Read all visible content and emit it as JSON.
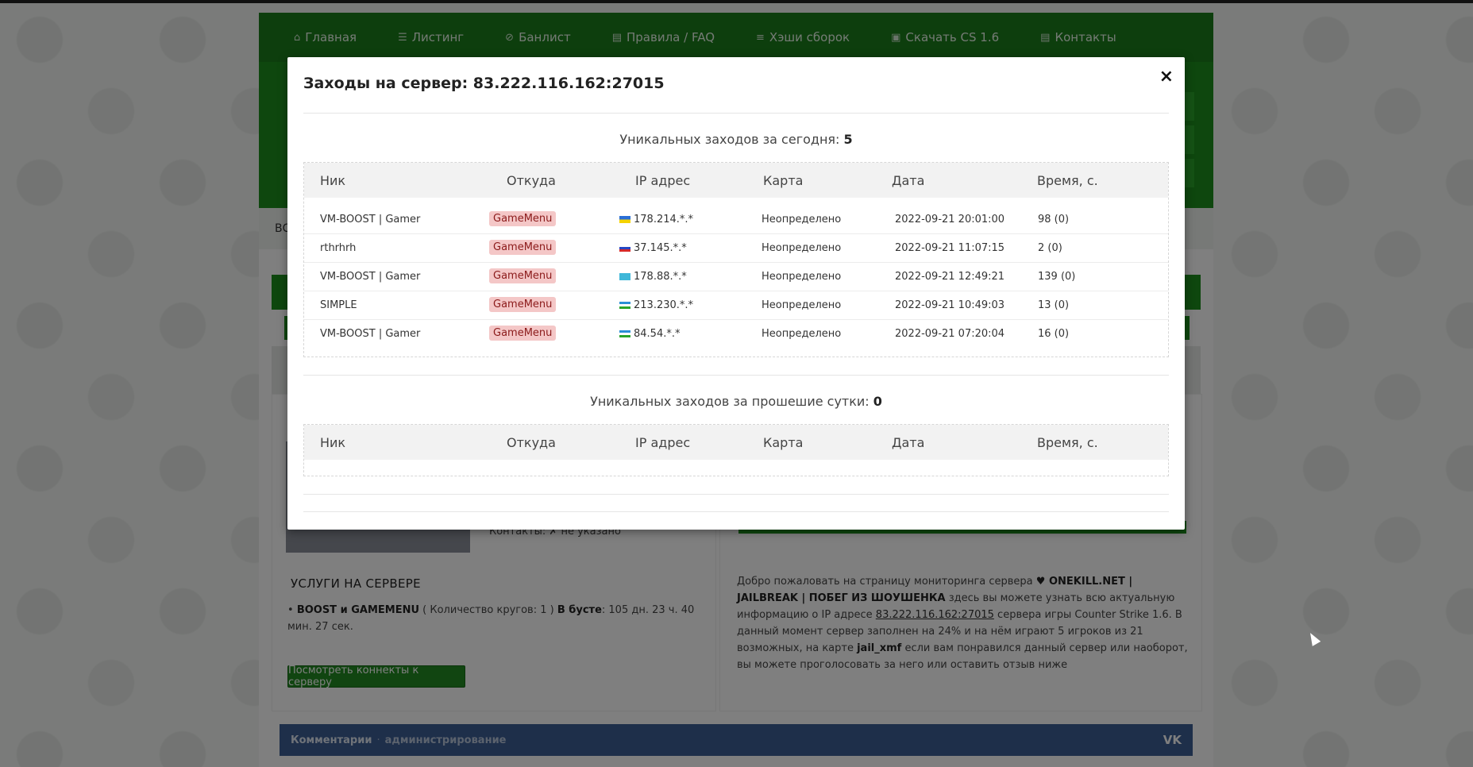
{
  "nav": {
    "items": [
      {
        "label": "Главная",
        "icon": "home-icon",
        "glyph": "⌂"
      },
      {
        "label": "Листинг",
        "icon": "list-icon",
        "glyph": "☰"
      },
      {
        "label": "Банлист",
        "icon": "ban-icon",
        "glyph": "⊘"
      },
      {
        "label": "Правила / FAQ",
        "icon": "document-icon",
        "glyph": "▤"
      },
      {
        "label": "Хэши сборок",
        "icon": "database-icon",
        "glyph": "≡"
      },
      {
        "label": "Скачать CS 1.6",
        "icon": "folder-download-icon",
        "glyph": "▣"
      },
      {
        "label": "Контакты",
        "icon": "document-icon",
        "glyph": "▤"
      }
    ]
  },
  "background": {
    "strip_text": "ВС",
    "contacts": "Контакты: ✗ не указано",
    "services_title": "УСЛУГИ НА СЕРВЕРЕ",
    "service": {
      "name": "BOOST и GAMEMENU",
      "rounds": "( Количество кругов: 1 )",
      "boost_label": "В бусте",
      "boost_value": ": 105 дн. 23 ч. 40 мин. 27 сек."
    },
    "connects_button": "Посмотреть коннекты к серверу",
    "welcome": {
      "p1": "Добро пожаловать на страницу мониторинга сервера ",
      "server_name": "♥ ONEKILL.NET | JAILBREAK | ПОБЕГ ИЗ ШОУШЕНКА",
      "p2": " здесь вы можете узнать всю актуальную информацию о IP адресе ",
      "ip": "83.222.116.162:27015",
      "p3": " сервера игры Counter Strike 1.6. В данный момент сервер заполнен на 24% и на нём играют 5 игроков из 21 возможных, на карте ",
      "map": "jail_xmf",
      "p4": " если вам понравился данный сервер или наоборот, вы можете проголосовать за него или оставить отзыв ниже"
    },
    "comments": {
      "label": "Комментарии",
      "sep": "·",
      "admin": "администрирование",
      "vk": "VK"
    }
  },
  "modal": {
    "title": "Заходы на сервер: 83.222.116.162:27015",
    "close": "×",
    "today_label": "Уникальных заходов за сегодня:",
    "today_count": "5",
    "yesterday_label": "Уникальных заходов за прошешие сутки:",
    "yesterday_count": "0",
    "columns": [
      "Ник",
      "Откуда",
      "IP адрес",
      "Карта",
      "Дата",
      "Время, с."
    ],
    "rows": [
      {
        "nick": "VM-BOOST | Gamer",
        "source": "GameMenu",
        "flag": "UA",
        "ip": "178.214.*.*",
        "map": "Неопределено",
        "date": "2022-09-21 20:01:00",
        "time": "98 (0)"
      },
      {
        "nick": "rthrhrh",
        "source": "GameMenu",
        "flag": "RU",
        "ip": "37.145.*.*",
        "map": "Неопределено",
        "date": "2022-09-21 11:07:15",
        "time": "2 (0)"
      },
      {
        "nick": "VM-BOOST | Gamer",
        "source": "GameMenu",
        "flag": "KZ",
        "ip": "178.88.*.*",
        "map": "Неопределено",
        "date": "2022-09-21 12:49:21",
        "time": "139 (0)"
      },
      {
        "nick": "SIMPLE",
        "source": "GameMenu",
        "flag": "UZ",
        "ip": "213.230.*.*",
        "map": "Неопределено",
        "date": "2022-09-21 10:49:03",
        "time": "13 (0)"
      },
      {
        "nick": "VM-BOOST | Gamer",
        "source": "GameMenu",
        "flag": "UZ",
        "ip": "84.54.*.*",
        "map": "Неопределено",
        "date": "2022-09-21 07:20:04",
        "time": "16 (0)"
      }
    ]
  },
  "colors": {
    "nav": "#1a7d1a",
    "accent": "#1d8f1d",
    "label_bg": "#f4c7c7",
    "label_fg": "#8b1a1a",
    "comments": "#3d5f95"
  }
}
